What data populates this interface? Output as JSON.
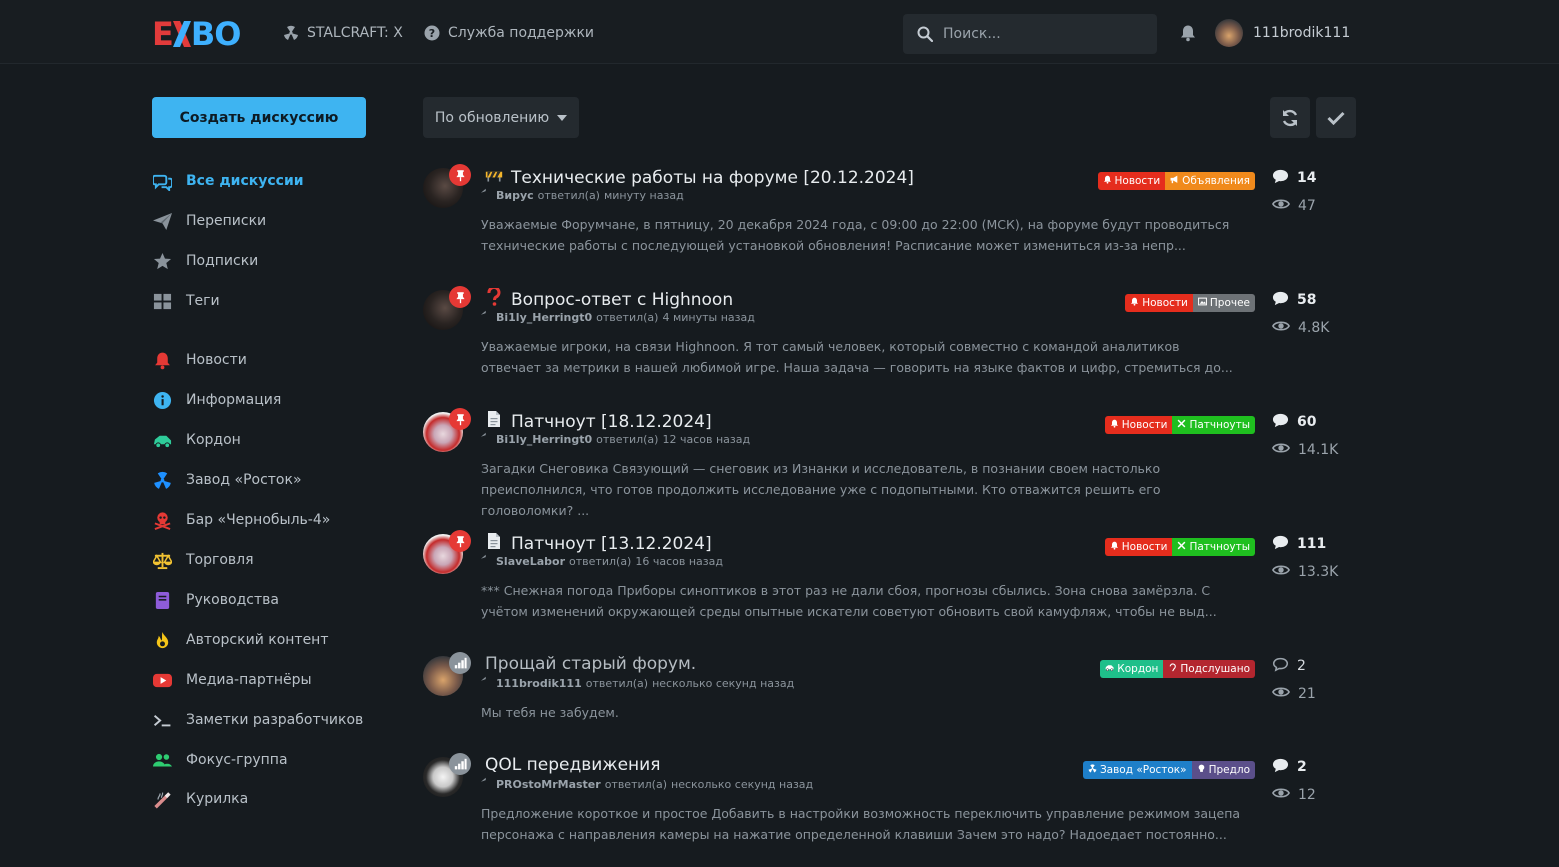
{
  "header": {
    "nav": [
      {
        "label": "STALCRAFT: X",
        "icon": "radiation-icon"
      },
      {
        "label": "Служба поддержки",
        "icon": "question-circle-icon"
      }
    ],
    "search_placeholder": "Поиск...",
    "username": "111brodik111"
  },
  "sidebar": {
    "create_label": "Создать дискуссию",
    "items": [
      {
        "label": "Все дискуссии",
        "icon": "comments-icon",
        "color": "#3eb4f1",
        "active": true
      },
      {
        "label": "Переписки",
        "icon": "paper-plane-icon",
        "color": "#8a939b"
      },
      {
        "label": "Подписки",
        "icon": "star-icon",
        "color": "#8a939b"
      },
      {
        "label": "Теги",
        "icon": "grid-icon",
        "color": "#8a939b"
      },
      {
        "label": "Новости",
        "icon": "bell-icon",
        "color": "#e53935"
      },
      {
        "label": "Информация",
        "icon": "info-icon",
        "color": "#3eb4f1"
      },
      {
        "label": "Кордон",
        "icon": "car-icon",
        "color": "#2ecc9a"
      },
      {
        "label": "Завод «Росток»",
        "icon": "radiation-icon",
        "color": "#1e90ff"
      },
      {
        "label": "Бар «Чернобыль-4»",
        "icon": "skull-icon",
        "color": "#e53935"
      },
      {
        "label": "Торговля",
        "icon": "scales-icon",
        "color": "#f1c232"
      },
      {
        "label": "Руководства",
        "icon": "book-icon",
        "color": "#8e5cd9"
      },
      {
        "label": "Авторский контент",
        "icon": "fire-icon",
        "color": "#f5c518"
      },
      {
        "label": "Медиа-партнёры",
        "icon": "youtube-icon",
        "color": "#e53935"
      },
      {
        "label": "Заметки разработчиков",
        "icon": "terminal-icon",
        "color": "#c5ccd3"
      },
      {
        "label": "Фокус-группа",
        "icon": "users-icon",
        "color": "#2ecc71"
      },
      {
        "label": "Курилка",
        "icon": "smoking-icon",
        "color": "#d98c8c"
      }
    ]
  },
  "toolbar": {
    "sort_label": "По обновлению"
  },
  "discussions": [
    {
      "title": "Технические работы на форуме [20.12.2024]",
      "title_icon": "roadblock-icon",
      "author": "Вирус",
      "action": "ответил(а)",
      "time": "минуту назад",
      "excerpt": "Уважаемые Форумчане, в пятницу, 20 декабря 2024 года, с 09:00 до 22:00 (МСК), на форуме будут проводиться технические работы с последующей установкой обновления! Расписание может измениться из-за непр...",
      "tags": [
        {
          "label": "Новости",
          "icon": "bell-icon",
          "color": "#e52d1d"
        },
        {
          "label": "Объявления",
          "icon": "megaphone-icon",
          "color": "#f08a1c"
        }
      ],
      "replies": "14",
      "views": "47",
      "pinned": true,
      "unread": true
    },
    {
      "title": "Вопрос-ответ с Highnoon",
      "title_icon": "question-mark-icon",
      "author": "Bi1ly_Herringt0",
      "action": "ответил(а)",
      "time": "4 минуты назад",
      "excerpt": "Уважаемые игроки, на связи Highnoon. Я тот самый человек, который совместно с командой аналитиков отвечает за метрики в нашей любимой игре. Наша задача — говорить на языке фактов и цифр, стремиться до...",
      "tags": [
        {
          "label": "Новости",
          "icon": "bell-icon",
          "color": "#e52d1d"
        },
        {
          "label": "Прочее",
          "icon": "image-icon",
          "color": "#6d7276"
        }
      ],
      "replies": "58",
      "views": "4.8K",
      "pinned": true,
      "unread": true
    },
    {
      "title": "Патчноут [18.12.2024]",
      "title_icon": "document-icon",
      "author": "Bi1ly_Herringt0",
      "action": "ответил(а)",
      "time": "12 часов назад",
      "excerpt": "Загадки Снеговика Связующий — снеговик из Изнанки и исследователь, в познании своем настолько преисполнился, что готов продолжить исследование уже с подопытными. Кто отважится решить его головоломки? ...",
      "tags": [
        {
          "label": "Новости",
          "icon": "bell-icon",
          "color": "#e52d1d"
        },
        {
          "label": "Патчноуты",
          "icon": "tools-icon",
          "color": "#1fbf1f"
        }
      ],
      "replies": "60",
      "views": "14.1K",
      "pinned": true,
      "unread": true
    },
    {
      "title": "Патчноут [13.12.2024]",
      "title_icon": "document-icon",
      "author": "SlaveLabor",
      "action": "ответил(а)",
      "time": "16 часов назад",
      "excerpt": "*** Снежная погода Приборы синоптиков в этот раз не дали сбоя, прогнозы сбылись. Зона снова замёрзла. С учётом изменений окружающей среды опытные искатели советуют обновить свой камуфляж, чтобы не выд...",
      "tags": [
        {
          "label": "Новости",
          "icon": "bell-icon",
          "color": "#e52d1d"
        },
        {
          "label": "Патчноуты",
          "icon": "tools-icon",
          "color": "#1fbf1f"
        }
      ],
      "replies": "111",
      "views": "13.3K",
      "pinned": true,
      "unread": true
    },
    {
      "title": "Прощай старый форум.",
      "title_icon": "",
      "author": "111brodik111",
      "action": "ответил(а)",
      "time": "несколько секунд назад",
      "excerpt": "Мы тебя не забудем.",
      "tags": [
        {
          "label": "Кордон",
          "icon": "car-icon",
          "color": "#1fbf8a"
        },
        {
          "label": "Подслушано",
          "icon": "ear-icon",
          "color": "#b3262f"
        }
      ],
      "replies": "2",
      "views": "21",
      "pinned": false,
      "unread": false
    },
    {
      "title": "QOL передвижения",
      "title_icon": "",
      "author": "PROstoMrMaster",
      "action": "ответил(а)",
      "time": "несколько секунд назад",
      "excerpt": "Предложение короткое и простое Добавить в настройки возможность переключить управление режимом зацепа персонажа с направления камеры на нажатие определенной клавиши Зачем это надо? Надоедает постоянно...",
      "tags": [
        {
          "label": "Завод «Росток»",
          "icon": "radiation-icon",
          "color": "#1e7fc9"
        },
        {
          "label": "Предло",
          "icon": "bulb-icon",
          "color": "#5b4f8a"
        }
      ],
      "replies": "2",
      "views": "12",
      "pinned": false,
      "unread": true
    }
  ]
}
